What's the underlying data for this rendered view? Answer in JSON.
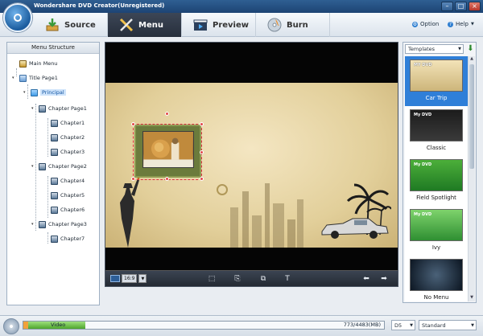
{
  "window": {
    "title": "Wondershare DVD Creator(Unregistered)"
  },
  "tabs": [
    {
      "label": "Source",
      "icon": "source-icon"
    },
    {
      "label": "Menu",
      "icon": "menu-tools-icon",
      "active": true
    },
    {
      "label": "Preview",
      "icon": "preview-icon"
    },
    {
      "label": "Burn",
      "icon": "burn-icon"
    }
  ],
  "toolbar": {
    "option_label": "Option",
    "help_label": "Help"
  },
  "menu_structure": {
    "title": "Menu Structure",
    "items": [
      {
        "label": "Main Menu",
        "icon": "home-icon"
      },
      {
        "label": "Title Page1",
        "icon": "page-icon"
      },
      {
        "label": "Principal",
        "icon": "folder-icon",
        "selected": true
      },
      {
        "label": "Chapter Page1",
        "icon": "film-icon"
      },
      {
        "label": "Chapter1",
        "icon": "film-icon"
      },
      {
        "label": "Chapter2",
        "icon": "film-icon"
      },
      {
        "label": "Chapter3",
        "icon": "film-icon"
      },
      {
        "label": "Chapter Page2",
        "icon": "film-icon"
      },
      {
        "label": "Chapter4",
        "icon": "film-icon"
      },
      {
        "label": "Chapter5",
        "icon": "film-icon"
      },
      {
        "label": "Chapter6",
        "icon": "film-icon"
      },
      {
        "label": "Chapter Page3",
        "icon": "film-icon"
      },
      {
        "label": "Chapter7",
        "icon": "film-icon"
      }
    ]
  },
  "preview": {
    "aspect_ratio": "16:9"
  },
  "templates": {
    "dropdown_value": "Templates",
    "items": [
      {
        "label": "Car Trip",
        "selected": true,
        "thumb_text": "MY DVD"
      },
      {
        "label": "Classic",
        "thumb_text": "My DVD"
      },
      {
        "label": "Field Spotlight",
        "thumb_text": "My DVD"
      },
      {
        "label": "Ivy",
        "thumb_text": "My DVD"
      },
      {
        "label": "No Menu",
        "thumb_text": ""
      }
    ]
  },
  "status": {
    "capacity_label": "Video",
    "capacity_size": "773/4483(MB)",
    "used_fraction": 0.172,
    "disc_type": "D5",
    "quality": "Standard"
  },
  "colors": {
    "accent": "#2f7fd8",
    "tab_active": "#2b3340",
    "capacity_fill": "#4ea52d"
  }
}
